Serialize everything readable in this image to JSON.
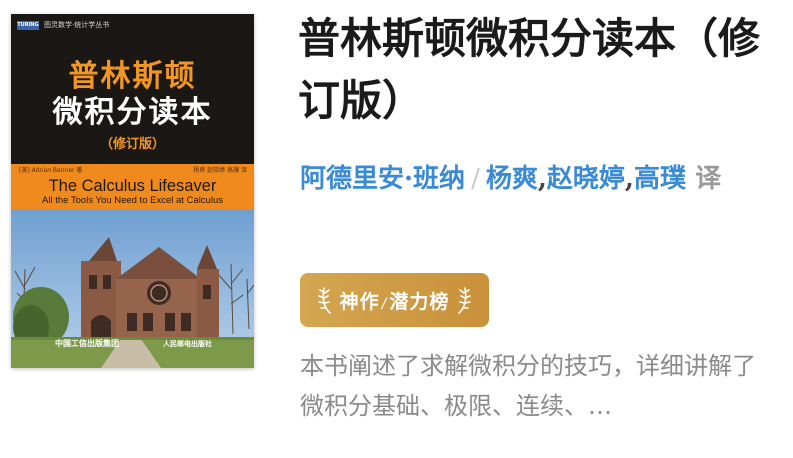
{
  "book": {
    "title": "普林斯顿微积分读本（修订版）",
    "authors": {
      "author": "阿德里安·班纳",
      "separator": "/",
      "translators": [
        "杨爽",
        "赵晓婷",
        "高璞"
      ],
      "translator_suffix": "译"
    },
    "badge": {
      "left": "神作",
      "slash": "/",
      "right": "潜力榜"
    },
    "description": "本书阐述了求解微积分的技巧，详细讲解了微积分基础、极限、连续、…"
  },
  "cover": {
    "series_logo": "TURING",
    "series_name": "图灵数学·统计学丛书",
    "title_line1": "普林斯顿",
    "title_line2": "微积分读本",
    "edition": "（修订版）",
    "author_credit": "[美] Adrian Banner 著",
    "translator_credit": "杨爽 赵晓婷 高璞 译",
    "en_title": "The Calculus Lifesaver",
    "en_subtitle": "All the Tools You Need to Excel at Calculus",
    "publisher_left": "中国工信出版集团",
    "publisher_right": "人民邮电出版社"
  },
  "colors": {
    "cover_orange": "#f08a1c",
    "cover_dark": "#1a1714",
    "link_blue": "#3b8ad6",
    "badge_gold": "#cc9a45",
    "description_gray": "#8a8a8a"
  }
}
